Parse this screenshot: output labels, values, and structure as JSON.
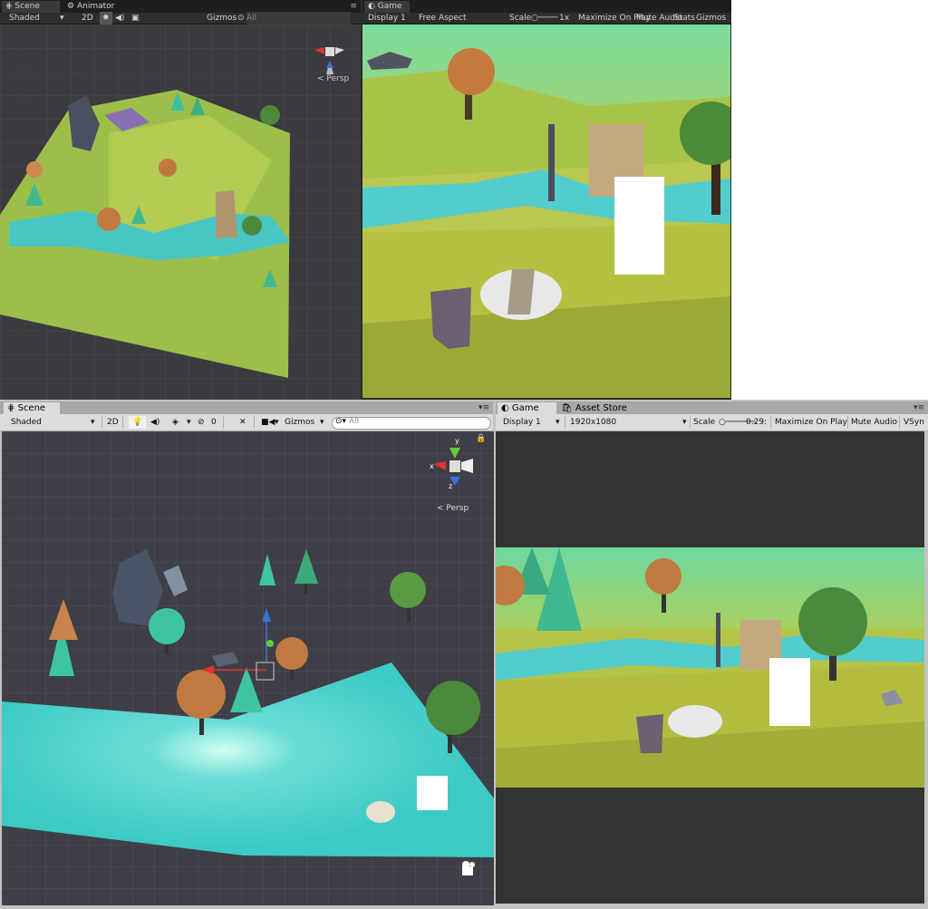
{
  "top_scene": {
    "tabs": [
      "Scene",
      "Animator"
    ],
    "toolbar": {
      "shading": "Shaded",
      "mode_2d": "2D",
      "gizmos": "Gizmos",
      "search": "All"
    },
    "persp": "Persp"
  },
  "top_game": {
    "tab": "Game",
    "toolbar": {
      "display": "Display 1",
      "aspect": "Free Aspect",
      "scale_label": "Scale",
      "scale_value": "1x",
      "maximize": "Maximize On Play",
      "mute": "Mute Audio",
      "stats": "Stats",
      "gizmos": "Gizmos"
    }
  },
  "bottom_scene": {
    "tab": "Scene",
    "toolbar": {
      "shading": "Shaded",
      "mode_2d": "2D",
      "hidden_count": "0",
      "gizmos": "Gizmos",
      "search": "All"
    },
    "persp": "Persp",
    "axis": {
      "x": "x",
      "y": "y",
      "z": "z"
    }
  },
  "bottom_game": {
    "tabs": [
      "Game",
      "Asset Store"
    ],
    "toolbar": {
      "display": "Display 1",
      "resolution": "1920x1080",
      "scale_label": "Scale",
      "scale_value": "0.29:",
      "maximize": "Maximize On Play",
      "mute": "Mute Audio",
      "vsync": "VSyn"
    }
  },
  "colors": {
    "grass": "#a8c850",
    "water": "#3cc8c8",
    "sky": "#6ed8a0",
    "scene_bg": "#3c3c44",
    "game_letterbox": "#333333"
  }
}
